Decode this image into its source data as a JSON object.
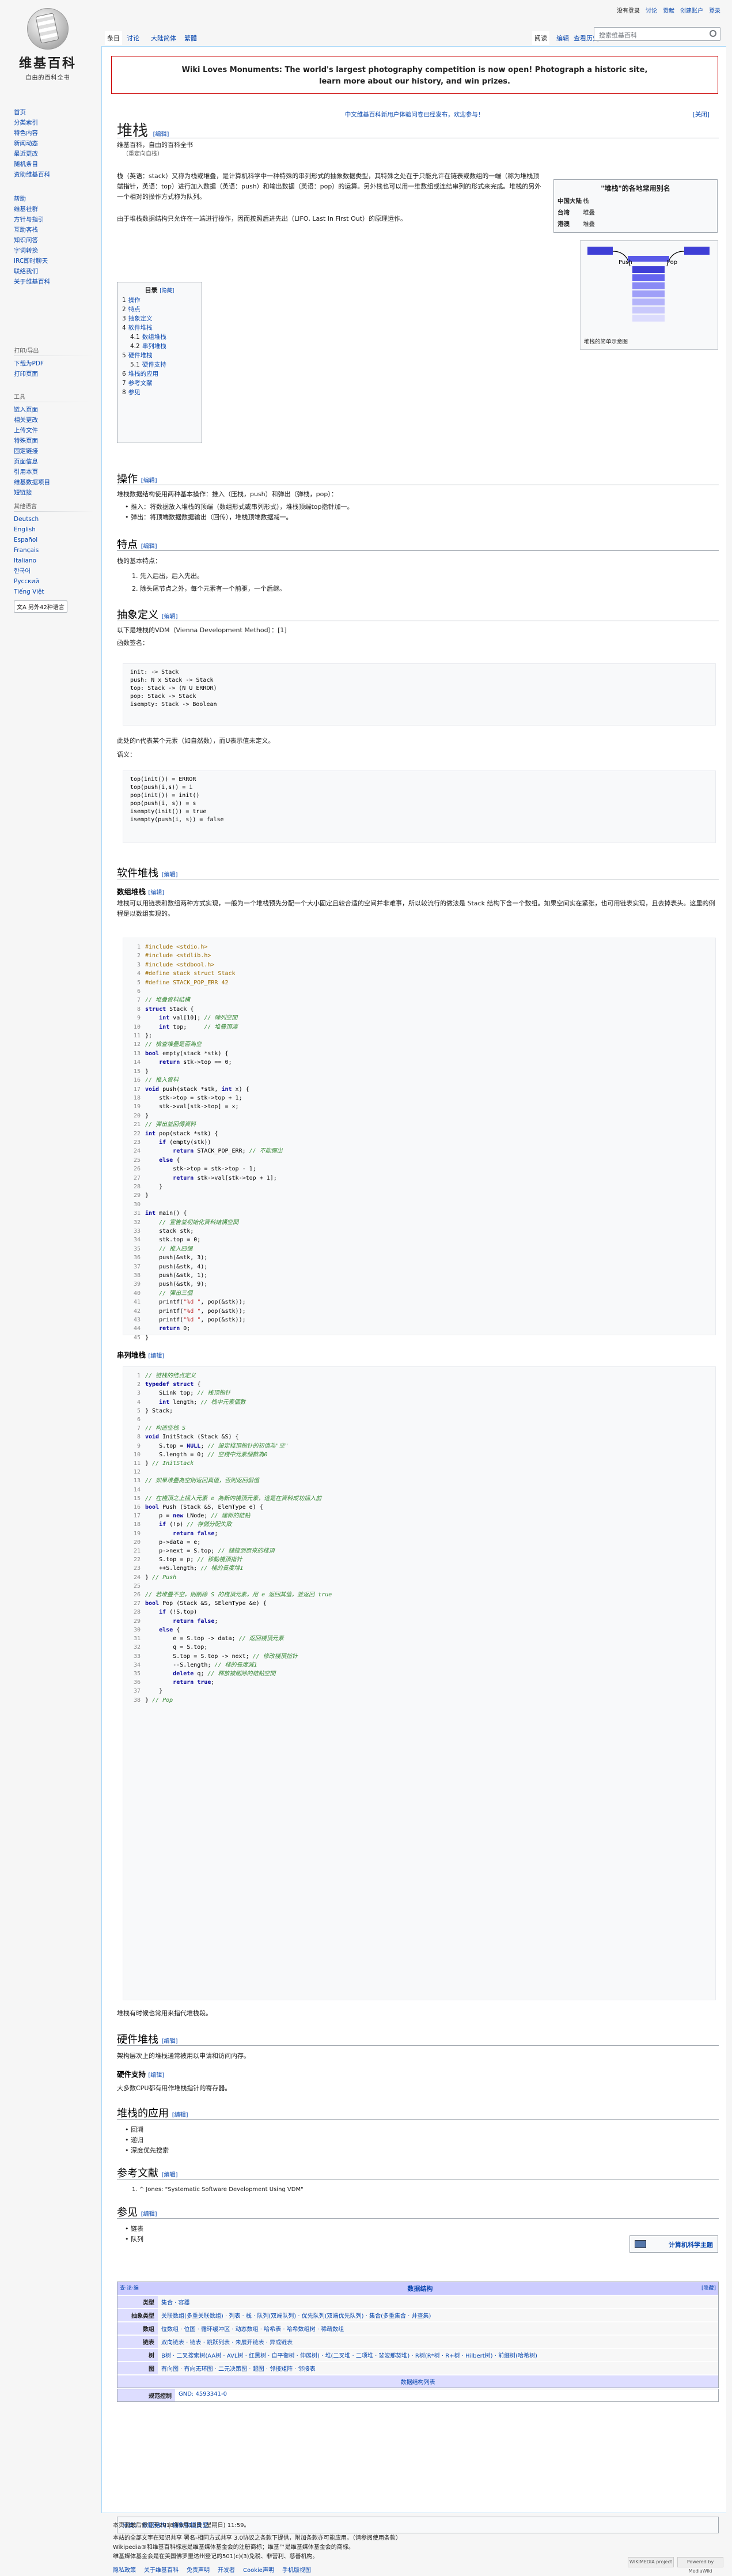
{
  "sidebar": {
    "logo": {
      "title": "维基百科",
      "subtitle": "自由的百科全书"
    },
    "nav": [
      "首页",
      "分类索引",
      "特色内容",
      "新闻动态",
      "最近更改",
      "随机条目",
      "资助维基百科"
    ],
    "help": [
      "帮助",
      "维基社群",
      "方针与指引",
      "互助客栈",
      "知识问答",
      "字词转换",
      "IRC即时聊天",
      "联络我们",
      "关于维基百科"
    ],
    "tools_title": "工具",
    "tools": [
      "链入页面",
      "相关更改",
      "上传文件",
      "特殊页面",
      "固定链接",
      "页面信息",
      "引用本页",
      "维基数据项目",
      "短链接"
    ],
    "print_title": "打印/导出",
    "print": [
      "下载为PDF",
      "打印页面"
    ],
    "other_title": "其他项目",
    "other": [
      "维基共享资源"
    ],
    "lang_title": "其他语言",
    "langs": [
      "Deutsch",
      "English",
      "Español",
      "Français",
      "Italiano",
      "한국어",
      "Русский",
      "Tiếng Việt"
    ],
    "lang_more": "另外42种语言"
  },
  "header": {
    "tabs_left": [
      "条目",
      "讨论",
      "大陆简体",
      "繁體"
    ],
    "tabs_right": [
      "阅读",
      "编辑",
      "查看历史"
    ],
    "search_placeholder": "搜索维基百科",
    "personal": [
      "没有登录",
      "讨论",
      "贡献",
      "创建账户",
      "登录"
    ]
  },
  "banner": {
    "line1": "Wiki Loves Monuments: The world's largest photography competition is now open! Photograph a historic site,",
    "line2": "learn more about our history, and win prizes."
  },
  "sitenotice": "中文维基百科新用户体验问卷已经发布，欢迎参与！",
  "sitenotice_right": "[关闭]",
  "title": "堆栈",
  "edit": "[编辑]",
  "from": "维基百科，自由的百科全书",
  "redirect": "（重定向自栈）",
  "intro1": "栈（英语：stack）又称为栈或堆叠，是计算机科学中一种特殊的串列形式的抽象数据类型，其特殊之处在于只能允许在链表或数组的一端（称为堆栈顶端指针，英语：top）进行加入数据（英语：push）和输出数据（英语：pop）的运算。另外栈也可以用一维数组或连结串列的形式来完成。堆栈的另外一个相对的操作方式称为队列。",
  "intro2": "由于堆栈数据结构只允许在一端进行操作，因而按照后进先出（LIFO, Last In First Out）的原理运作。",
  "infobox": {
    "caption": "\"堆栈\"的各地常用别名",
    "rows": [
      [
        "中国大陆",
        "栈"
      ],
      [
        "台湾",
        "堆叠"
      ],
      [
        "港澳",
        "堆叠"
      ]
    ]
  },
  "thumb": {
    "push": "Push",
    "pop": "Pop",
    "caption": "堆栈的简单示意图"
  },
  "toc": {
    "title": "目录",
    "hide": "[隐藏]",
    "items": [
      [
        "1",
        "操作"
      ],
      [
        "2",
        "特点"
      ],
      [
        "3",
        "抽象定义"
      ],
      [
        "4",
        "软件堆栈"
      ],
      [
        "4.1",
        "数组堆栈"
      ],
      [
        "4.2",
        "串列堆栈"
      ],
      [
        "5",
        "硬件堆栈"
      ],
      [
        "5.1",
        "硬件支持"
      ],
      [
        "6",
        "堆栈的应用"
      ],
      [
        "7",
        "参考文献"
      ],
      [
        "8",
        "参见"
      ]
    ]
  },
  "sections": {
    "ops": {
      "title": "操作",
      "text": "堆栈数据结构使用两种基本操作：推入（压栈，push）和弹出（弹栈，pop）：",
      "items": [
        "推入：将数据放入堆栈的顶端（数组形式或串列形式），堆栈顶端top指针加一。",
        "弹出：将顶端数据数据输出（回传），堆栈顶端数据减一。"
      ]
    },
    "feat": {
      "title": "特点",
      "text": "栈的基本特点：",
      "items": [
        "先入后出，后入先出。",
        "除头尾节点之外，每个元素有一个前驱，一个后继。"
      ]
    },
    "abs": {
      "title": "抽象定义",
      "text1": "以下是堆栈的VDM（Vienna Development Method）：[1]",
      "text2": "函数签名：",
      "text3": "此处的n代表某个元素（如自然数），而U表示值未定义。",
      "text4": "语义："
    },
    "soft": {
      "title": "软件堆栈",
      "arr_title": "数组堆栈",
      "arr_text": "堆栈可以用链表和数组两种方式实现，一般为一个堆栈预先分配一个大小固定且较合适的空间并非难事，所以较流行的做法是 Stack 结构下含一个数组。如果空间实在紧张，也可用链表实现，且去掉表头。这里的例程是以数组实现的。",
      "list_title": "串列堆栈",
      "list_text": "堆栈有时候也常用来指代堆栈段。"
    },
    "hard": {
      "title": "硬件堆栈",
      "text": "架构层次上的堆栈通常被用以申请和访问内存。",
      "sup_title": "硬件支持",
      "sup_text": "大多数CPU都有用作堆栈指针的寄存器。"
    },
    "app": {
      "title": "堆栈的应用",
      "items": [
        "回溯",
        "递归",
        "深度优先搜索"
      ]
    },
    "ref": {
      "title": "参考文献",
      "items": [
        "^ Jones: \"Systematic Software Development Using VDM\""
      ]
    },
    "see": {
      "title": "参见",
      "items": [
        "链表",
        "队列"
      ],
      "box": "计算机科学主题"
    }
  },
  "navbox": {
    "hide": "[隐藏]",
    "edit": "查·论·编",
    "title": "数据结构",
    "rows": [
      [
        "类型",
        "集合 · 容器"
      ],
      [
        "抽象类型",
        "关联数组(多重关联数组) · 列表 · 栈 · 队列(双端队列) · 优先队列(双端优先队列) · 集合(多重集合 · 并查集)"
      ],
      [
        "数组",
        "位数组 · 位图 · 循环缓冲区 · 动态数组 · 哈希表 · 哈希数组树 · 稀疏数组"
      ],
      [
        "链表",
        "双向链表 · 链表 · 跳跃列表 · 未展开链表 · 异或链表"
      ],
      [
        "树",
        "B树 · 二叉搜索树(AA树 · AVL树 · 红黑树 · 自平衡树 · 伸展树) · 堆(二叉堆 · 二项堆 · 斐波那契堆) · R树(R*树 · R+树 · Hilbert树) · 前缀树(哈希树)"
      ],
      [
        "图",
        "有向图 · 有向无环图 · 二元决策图 · 超图 · 邻接矩阵 · 邻接表"
      ]
    ],
    "foot": "数据结构列表",
    "ctrl_label": "规范控制",
    "ctrl_val": "GND: 4593341-0"
  },
  "categories": {
    "label": "分类：",
    "items": [
      "数据结构",
      "抽象数据类型"
    ]
  },
  "footer": {
    "l1": "本页面最后修订于2018年6月10日 (星期日) 11:59。",
    "l2": "本站的全部文字在知识共享 署名-相同方式共享 3.0协议之条款下提供，附加条款亦可能应用。（请参阅使用条款）",
    "l3": "Wikipedia®和维基百科标志是维基媒体基金会的注册商标；维基™是维基媒体基金会的商标。",
    "l4": "维基媒体基金会是在美国佛罗里达州登记的501(c)(3)免税、非营利、慈善机构。",
    "links": [
      "隐私政策",
      "关于维基百科",
      "免责声明",
      "开发者",
      "Cookie声明",
      "手机版视图"
    ],
    "badge1": "WIKIMEDIA project",
    "badge2": "Powered by MediaWiki"
  }
}
